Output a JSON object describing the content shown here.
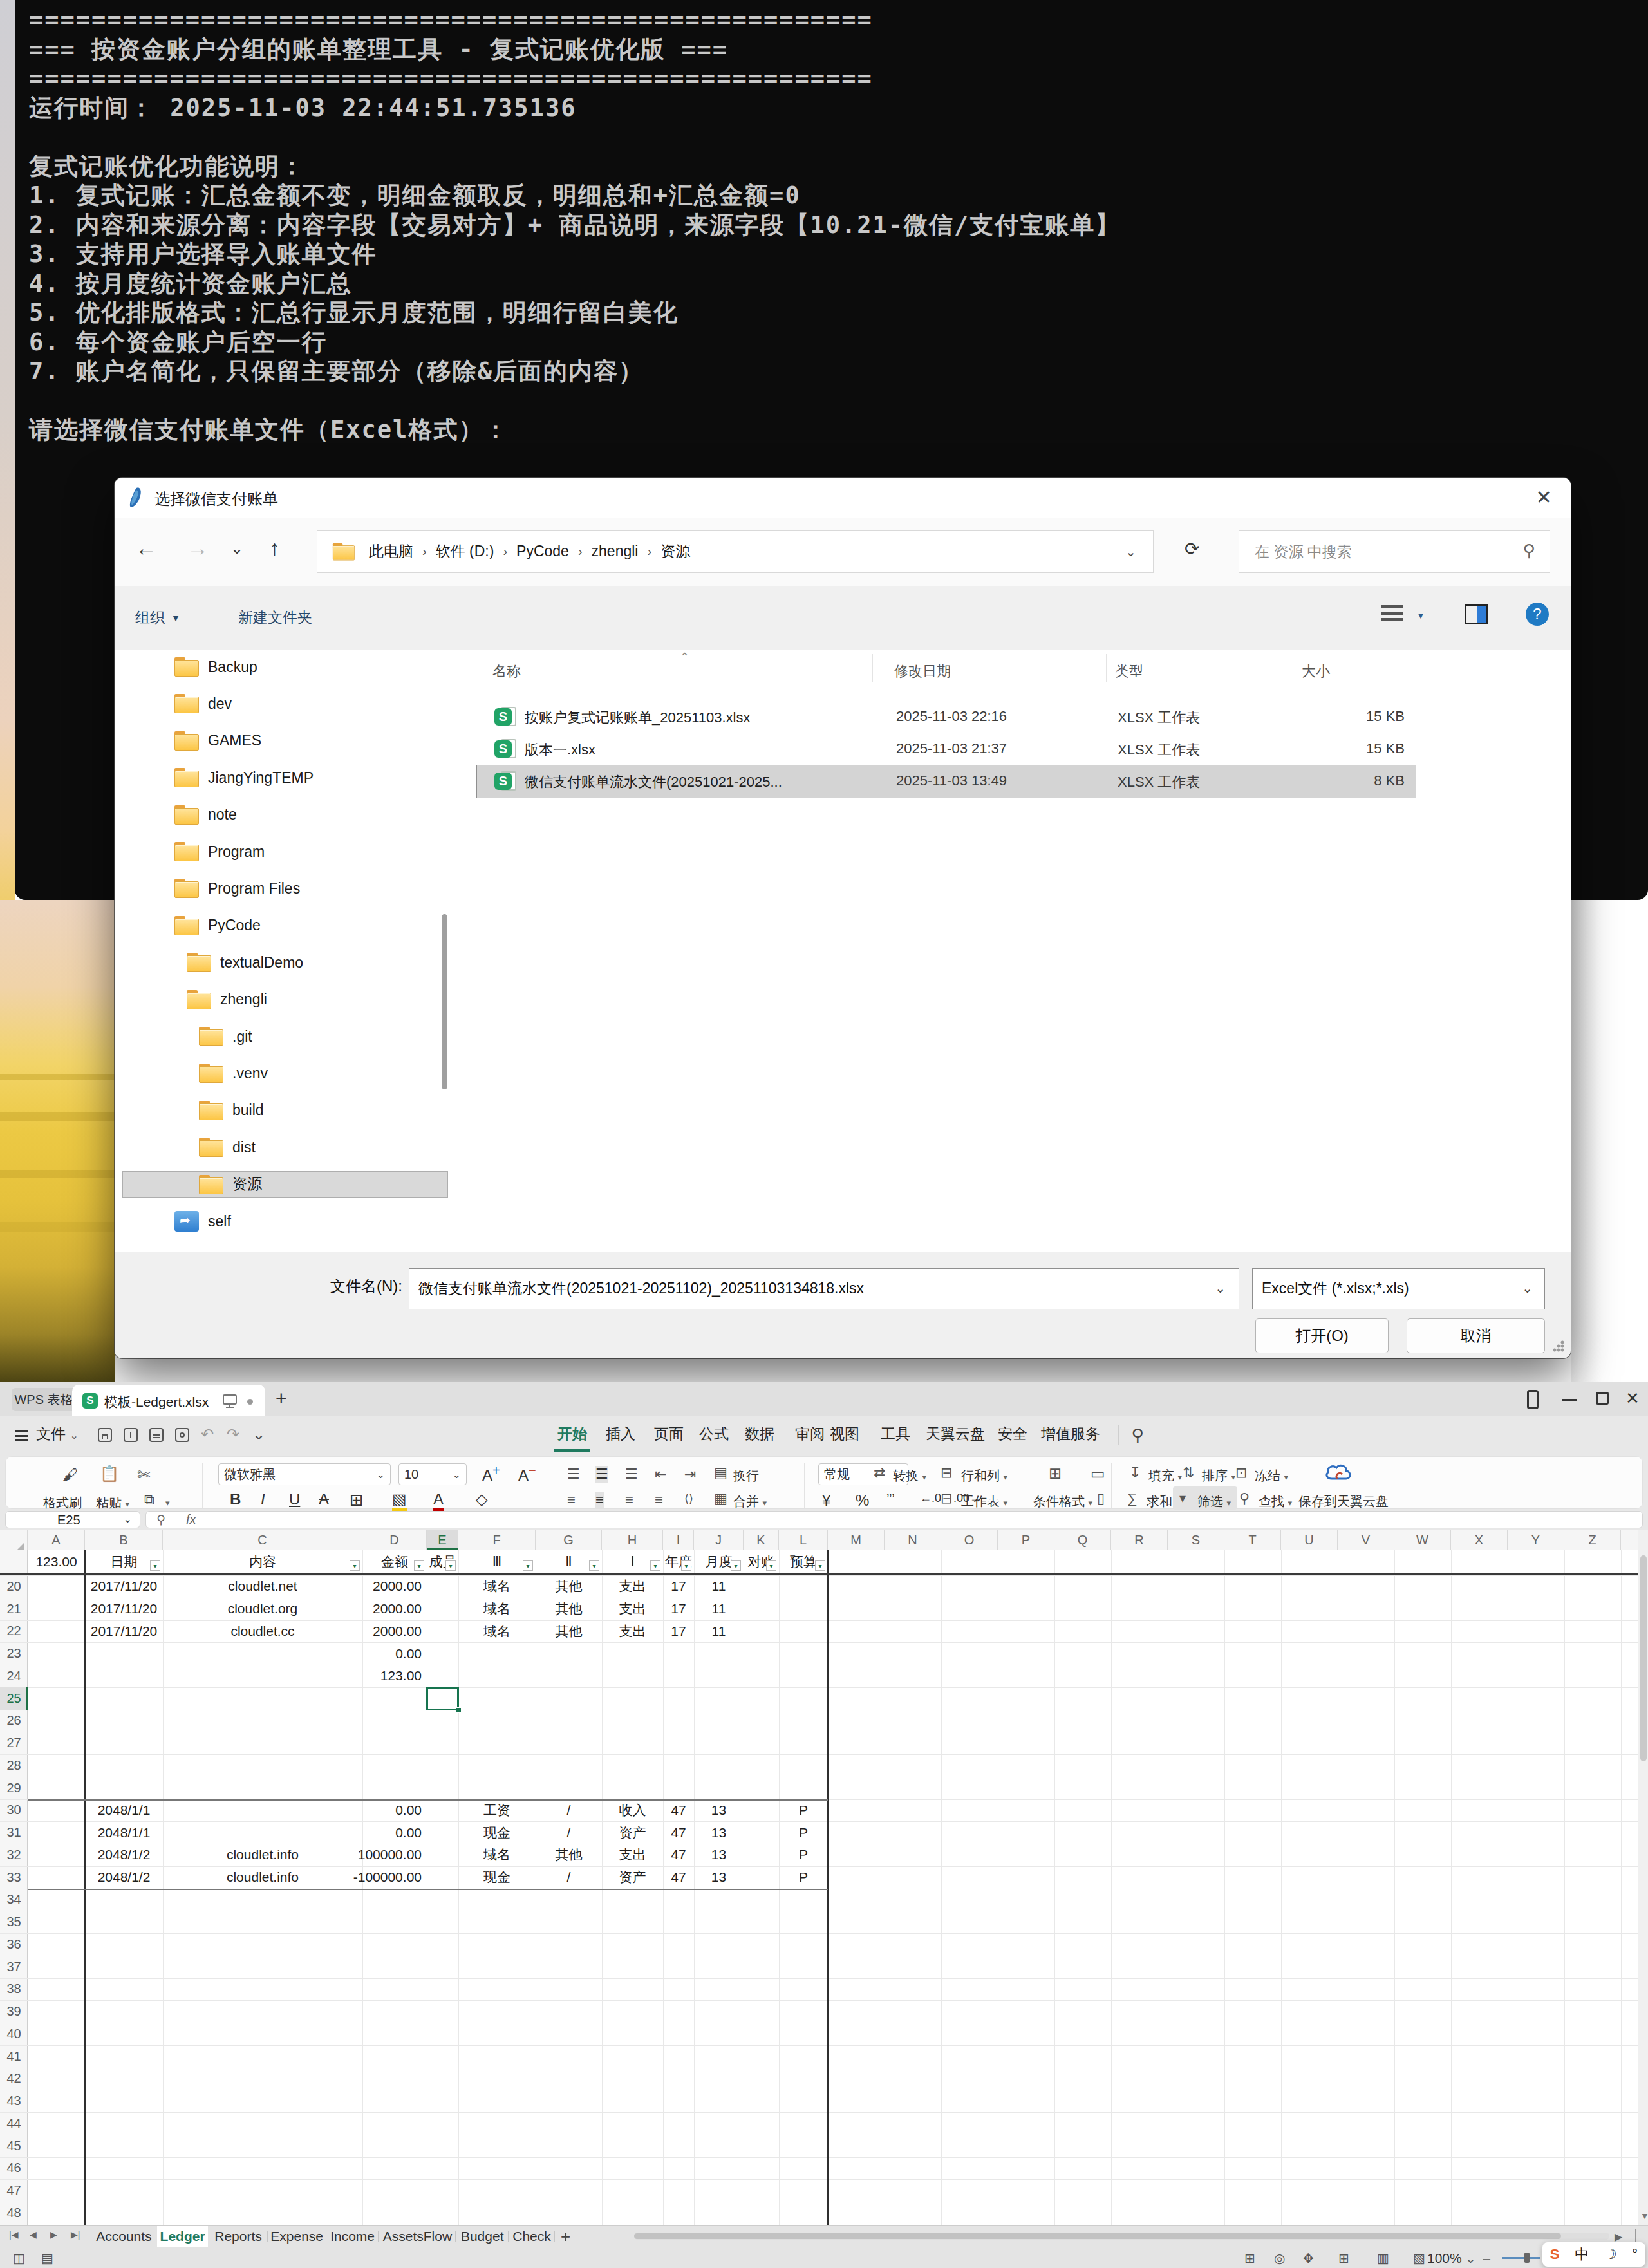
{
  "console": {
    "lines": [
      "======================================================",
      "=== 按资金账户分组的账单整理工具 - 复式记账优化版 ===",
      "======================================================",
      "运行时间： 2025-11-03 22:44:51.735136",
      "",
      "复式记账优化功能说明：",
      "1. 复式记账：汇总金额不变，明细金额取反，明细总和+汇总金额=0",
      "2. 内容和来源分离：内容字段【交易对方】+ 商品说明，来源字段【10.21-微信/支付宝账单】",
      "3. 支持用户选择导入账单文件",
      "4. 按月度统计资金账户汇总",
      "5. 优化排版格式：汇总行显示月度范围，明细行留白美化",
      "6. 每个资金账户后空一行",
      "7. 账户名简化，只保留主要部分（移除&后面的内容）",
      "",
      "请选择微信支付账单文件（Excel格式）："
    ]
  },
  "dialog": {
    "title": "选择微信支付账单",
    "close_glyph": "✕",
    "breadcrumb": [
      "此电脑",
      "软件 (D:)",
      "PyCode",
      "zhengli",
      "资源"
    ],
    "search_placeholder": "在 资源 中搜索",
    "toolbar": {
      "organize": "组织",
      "new_folder": "新建文件夹"
    },
    "sidebar": [
      {
        "label": "Backup",
        "level": 0,
        "icon": "folder"
      },
      {
        "label": "dev",
        "level": 0,
        "icon": "folder"
      },
      {
        "label": "GAMES",
        "level": 0,
        "icon": "folder"
      },
      {
        "label": "JiangYingTEMP",
        "level": 0,
        "icon": "folder"
      },
      {
        "label": "note",
        "level": 0,
        "icon": "folder"
      },
      {
        "label": "Program",
        "level": 0,
        "icon": "folder"
      },
      {
        "label": "Program Files",
        "level": 0,
        "icon": "folder"
      },
      {
        "label": "PyCode",
        "level": 0,
        "icon": "folder"
      },
      {
        "label": "textualDemo",
        "level": 1,
        "icon": "folder"
      },
      {
        "label": "zhengli",
        "level": 1,
        "icon": "folder"
      },
      {
        "label": ".git",
        "level": 2,
        "icon": "folder"
      },
      {
        "label": ".venv",
        "level": 2,
        "icon": "folder"
      },
      {
        "label": "build",
        "level": 2,
        "icon": "folder"
      },
      {
        "label": "dist",
        "level": 2,
        "icon": "folder"
      },
      {
        "label": "资源",
        "level": 2,
        "icon": "folder",
        "selected": true
      },
      {
        "label": "self",
        "level": 0,
        "icon": "bluefolder"
      }
    ],
    "list": {
      "columns": [
        "名称",
        "修改日期",
        "类型",
        "大小"
      ],
      "files": [
        {
          "name": "按账户复式记账账单_20251103.xlsx",
          "date": "2025-11-03 22:16",
          "type": "XLSX 工作表",
          "size": "15 KB"
        },
        {
          "name": "版本一.xlsx",
          "date": "2025-11-03 21:37",
          "type": "XLSX 工作表",
          "size": "15 KB"
        },
        {
          "name": "微信支付账单流水文件(20251021-2025...",
          "date": "2025-11-03 13:49",
          "type": "XLSX 工作表",
          "size": "8 KB",
          "selected": true
        }
      ]
    },
    "filename_label": "文件名(N):",
    "filename_value": "微信支付账单流水文件(20251021-20251102)_20251103134818.xlsx",
    "filetype_value": "Excel文件 (*.xlsx;*.xls)",
    "open_button": "打开(O)",
    "cancel_button": "取消"
  },
  "wps": {
    "app_button": "WPS 表格",
    "doc_tab": "模板-Ledgert.xlsx",
    "new_tab": "+",
    "file_menu": "文件",
    "menu_tabs": [
      "开始",
      "插入",
      "页面",
      "公式",
      "数据",
      "审阅",
      "视图",
      "工具",
      "天翼云盘",
      "安全",
      "增值服务"
    ],
    "active_tab": "开始",
    "ribbon": {
      "format_painter": "格式刷",
      "paste": "粘贴",
      "font_name": "微软雅黑",
      "font_size": "10",
      "wrap": "换行",
      "merge": "合并",
      "number_format": "常规",
      "convert": "转换",
      "rows_cols": "行和列",
      "sheet": "工作表",
      "cond_format": "条件格式",
      "fill": "填充",
      "sort": "排序",
      "freeze": "冻结",
      "sum": "求和",
      "filter": "筛选",
      "find": "查找",
      "save_cloud": "保存到天翼云盘"
    },
    "name_box": "E25",
    "fx_label": "fx",
    "grid": {
      "col_widths": {
        "gutter": 43,
        "A": 89,
        "B": 121,
        "C": 310,
        "D": 100,
        "E": 49,
        "F": 120,
        "G": 103,
        "H": 95,
        "I": 48,
        "J": 77,
        "K": 55,
        "L": 76,
        "M": 88
      },
      "header_row": {
        "A": "123.00",
        "B": "日期",
        "C": "内容",
        "D": "金额",
        "E": "成员",
        "F": "Ⅲ",
        "G": "Ⅱ",
        "H": "Ⅰ",
        "I": "年度",
        "J": "月度",
        "K": "对账",
        "L": "预算"
      },
      "filter_cols": [
        "B",
        "C",
        "D",
        "E",
        "F",
        "G",
        "H",
        "I",
        "J",
        "K",
        "L"
      ],
      "first_row": 20,
      "last_row": 48,
      "selected_cell": {
        "col": "E",
        "row": 25
      },
      "rows": {
        "20": {
          "B": "2017/11/20",
          "C": "cloudlet.net",
          "D": "2000.00",
          "F": "域名",
          "G": "其他",
          "H": "支出",
          "I": "17",
          "J": "11"
        },
        "21": {
          "B": "2017/11/20",
          "C": "cloudlet.org",
          "D": "2000.00",
          "F": "域名",
          "G": "其他",
          "H": "支出",
          "I": "17",
          "J": "11"
        },
        "22": {
          "B": "2017/11/20",
          "C": "cloudlet.cc",
          "D": "2000.00",
          "F": "域名",
          "G": "其他",
          "H": "支出",
          "I": "17",
          "J": "11"
        },
        "23": {
          "D": "0.00"
        },
        "24": {
          "D": "123.00"
        },
        "30": {
          "B": "2048/1/1",
          "D": "0.00",
          "F": "工资",
          "G": "/",
          "H": "收入",
          "I": "47",
          "J": "13",
          "L": "P"
        },
        "31": {
          "B": "2048/1/1",
          "D": "0.00",
          "F": "现金",
          "G": "/",
          "H": "资产",
          "I": "47",
          "J": "13",
          "L": "P"
        },
        "32": {
          "B": "2048/1/2",
          "C": "cloudlet.info",
          "D": "100000.00",
          "F": "域名",
          "G": "其他",
          "H": "支出",
          "I": "47",
          "J": "13",
          "L": "P"
        },
        "33": {
          "B": "2048/1/2",
          "C": "cloudlet.info",
          "D": "-100000.00",
          "F": "现金",
          "G": "/",
          "H": "资产",
          "I": "47",
          "J": "13",
          "L": "P"
        }
      }
    },
    "sheet_tabs": [
      "Accounts",
      "Ledger",
      "Reports",
      "Expense",
      "Income",
      "AssetsFlow",
      "Budget",
      "Check"
    ],
    "active_sheet": "Ledger",
    "add_sheet": "+",
    "status": {
      "zoom": "100%"
    },
    "quickbar": [
      "S",
      "中",
      "☽",
      "°"
    ]
  }
}
